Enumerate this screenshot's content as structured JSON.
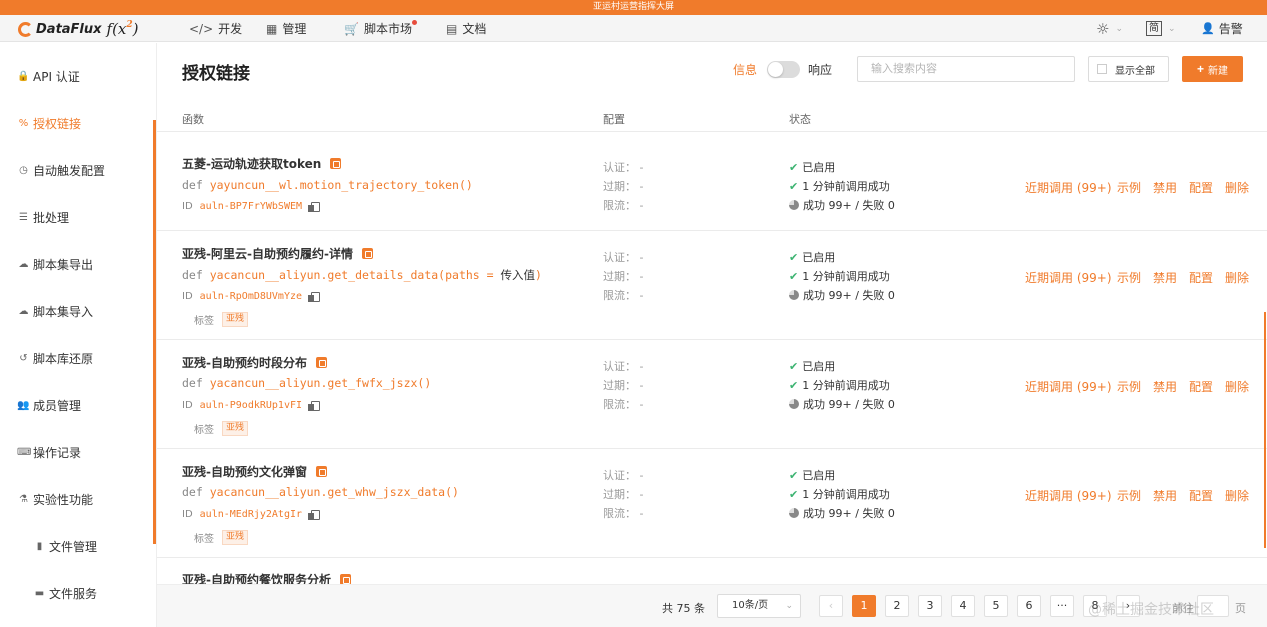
{
  "banner": "亚运村运营指挥大屏",
  "logo": {
    "text": "DataFlux",
    "fx": "f(x",
    "sup": "2",
    "close": ")"
  },
  "nav": [
    {
      "label": "开发",
      "icon": "code-icon"
    },
    {
      "label": "管理",
      "icon": "grid-icon"
    },
    {
      "label": "脚本市场",
      "icon": "cart-icon"
    },
    {
      "label": "文档",
      "icon": "book-icon"
    }
  ],
  "nav_right": {
    "lang": "简",
    "user": "告警"
  },
  "sidebar": [
    {
      "label": "API 认证",
      "icon": "lock-icon"
    },
    {
      "label": "授权链接",
      "icon": "link-icon",
      "active": true
    },
    {
      "label": "自动触发配置",
      "icon": "clock-icon"
    },
    {
      "label": "批处理",
      "icon": "tasks-icon"
    },
    {
      "label": "脚本集导出",
      "icon": "cloud-download-icon"
    },
    {
      "label": "脚本集导入",
      "icon": "cloud-upload-icon"
    },
    {
      "label": "脚本库还原",
      "icon": "history-icon"
    },
    {
      "label": "成员管理",
      "icon": "users-icon"
    },
    {
      "label": "操作记录",
      "icon": "keyboard-icon"
    },
    {
      "label": "实验性功能",
      "icon": "flask-icon"
    },
    {
      "label": "文件管理",
      "icon": "file-icon",
      "sub": true
    },
    {
      "label": "文件服务",
      "icon": "folder-icon",
      "sub": true
    }
  ],
  "header": {
    "title": "授权链接",
    "toggle_left": "信息",
    "toggle_right": "响应",
    "search_placeholder": "输入搜索内容",
    "show_all": "显示全部",
    "new_button": "新建"
  },
  "columns": {
    "func": "函数",
    "config": "配置",
    "status": "状态"
  },
  "rows": [
    {
      "name": "五菱-运动轨迹获取token",
      "def_prefix": "def ",
      "def_code": "yayuncun__wl.motion_trajectory_token()",
      "def_extra": "",
      "id_label": "ID",
      "id": "auln-BP7FrYWbSWEM",
      "tag_label": "",
      "tag": "",
      "cfg": [
        "认证： -",
        "过期： -",
        "限流： -"
      ],
      "status": [
        "已启用",
        "1 分钟前调用成功",
        "成功 99+ / 失败 0"
      ],
      "actions": [
        "近期调用 (99+)",
        "示例",
        "禁用",
        "配置",
        "删除"
      ]
    },
    {
      "name": "亚残-阿里云-自助预约履约-详情",
      "def_prefix": "def ",
      "def_code": "yacancun__aliyun.get_details_data(paths = ",
      "def_extra": "传入值",
      "def_close": ")",
      "id_label": "ID",
      "id": "auln-RpOmD8UVmYze",
      "tag_label": "标签",
      "tag": "亚残",
      "cfg": [
        "认证： -",
        "过期： -",
        "限流： -"
      ],
      "status": [
        "已启用",
        "1 分钟前调用成功",
        "成功 99+ / 失败 0"
      ],
      "actions": [
        "近期调用 (99+)",
        "示例",
        "禁用",
        "配置",
        "删除"
      ]
    },
    {
      "name": "亚残-自助预约时段分布",
      "def_prefix": "def ",
      "def_code": "yacancun__aliyun.get_fwfx_jszx()",
      "def_extra": "",
      "id_label": "ID",
      "id": "auln-P9odkRUp1vFI",
      "tag_label": "标签",
      "tag": "亚残",
      "cfg": [
        "认证： -",
        "过期： -",
        "限流： -"
      ],
      "status": [
        "已启用",
        "1 分钟前调用成功",
        "成功 99+ / 失败 0"
      ],
      "actions": [
        "近期调用 (99+)",
        "示例",
        "禁用",
        "配置",
        "删除"
      ]
    },
    {
      "name": "亚残-自助预约文化弹窗",
      "def_prefix": "def ",
      "def_code": "yacancun__aliyun.get_whw_jszx_data()",
      "def_extra": "",
      "id_label": "ID",
      "id": "auln-MEdRjy2AtgIr",
      "tag_label": "标签",
      "tag": "亚残",
      "cfg": [
        "认证： -",
        "过期： -",
        "限流： -"
      ],
      "status": [
        "已启用",
        "1 分钟前调用成功",
        "成功 99+ / 失败 0"
      ],
      "actions": [
        "近期调用 (99+)",
        "示例",
        "禁用",
        "配置",
        "删除"
      ]
    },
    {
      "name": "亚残-自助预约餐饮服务分析"
    }
  ],
  "pager": {
    "total": "共 75 条",
    "size": "10条/页",
    "prev": "‹",
    "pages": [
      "1",
      "2",
      "3",
      "4",
      "5",
      "6",
      "···",
      "8"
    ],
    "next": "›",
    "jump_label": "前往",
    "jump_unit": "页"
  },
  "watermark": "@稀土掘金技术社区",
  "colors": {
    "accent": "#f07b2b",
    "success": "#3cb371"
  }
}
